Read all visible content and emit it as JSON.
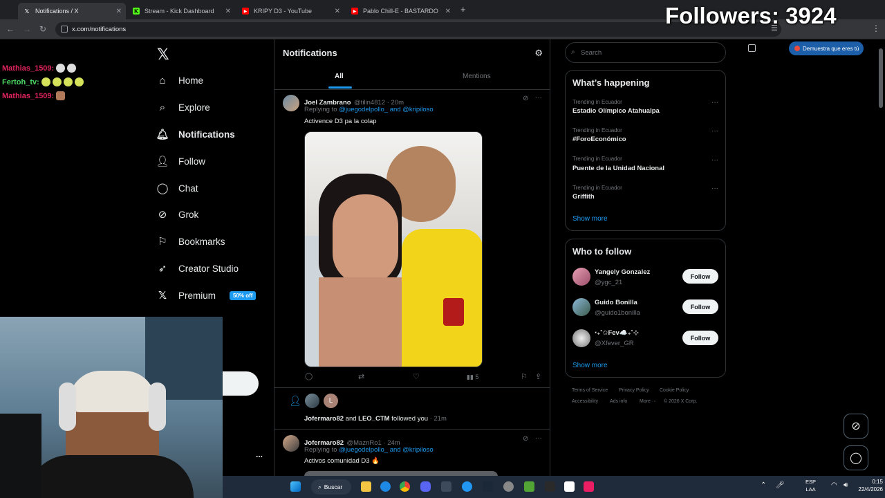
{
  "browser": {
    "tabs": [
      {
        "label": "Notifications / X",
        "icon": "x-icon",
        "active": true
      },
      {
        "label": "Stream - Kick Dashboard",
        "icon": "kick-icon",
        "active": false
      },
      {
        "label": "KRIPY D3 - YouTube",
        "icon": "youtube-icon",
        "active": false
      },
      {
        "label": "Pablo Chill-E - BASTARDO ft Ñe",
        "icon": "youtube-icon",
        "active": false
      }
    ],
    "url": "x.com/notifications",
    "verify_chip": "Demuestra que eres tú"
  },
  "overlay": {
    "followers": "Followers: 3924",
    "chat": [
      {
        "user": "Mathias_1509:",
        "color": "#e0245e"
      },
      {
        "user": "Fertoh_tv:",
        "color": "#4cd964"
      },
      {
        "user": "Mathias_1509:",
        "color": "#e0245e"
      }
    ]
  },
  "sidebar": {
    "items": [
      {
        "label": "Home",
        "icon": "home-icon"
      },
      {
        "label": "Explore",
        "icon": "search-icon"
      },
      {
        "label": "Notifications",
        "icon": "bell-icon"
      },
      {
        "label": "Follow",
        "icon": "add-person-icon"
      },
      {
        "label": "Chat",
        "icon": "chat-icon"
      },
      {
        "label": "Grok",
        "icon": "grok-icon"
      },
      {
        "label": "Bookmarks",
        "icon": "bookmark-icon"
      },
      {
        "label": "Creator Studio",
        "icon": "rocket-icon"
      },
      {
        "label": "Premium",
        "icon": "x-icon"
      }
    ],
    "premium_badge": "50% off",
    "more_dots": "..."
  },
  "main": {
    "title": "Notifications",
    "tabs": [
      "All",
      "Mentions"
    ],
    "posts": [
      {
        "name": "Joel Zambrano",
        "handle": "@tilin4812 · 20m",
        "replying_prefix": "Replying to",
        "reply_users": "@juegodelpollo_ and @kripiloso",
        "text": "Activence D3 pa la colap",
        "views": "5"
      },
      {
        "name": "Jofermaro82",
        "handle": "@MaznRo1 · 24m",
        "replying_prefix": "Replying to",
        "reply_users": "@juegodelpollo_ and @kripiloso",
        "text": "Activos comunidad D3 🔥"
      }
    ],
    "follow_notice": {
      "text_a": "Jofermaro82",
      "text_mid": "and",
      "text_b": "LEO_CTM",
      "text_end": "followed you",
      "time": "· 21m",
      "avatar_letter": "L"
    }
  },
  "right": {
    "search_placeholder": "Search",
    "trending_title": "What’s happening",
    "trends": [
      {
        "category": "Trending in Ecuador",
        "name": "Estadio Olímpico Atahualpa"
      },
      {
        "category": "Trending in Ecuador",
        "name": "#ForoEconómico"
      },
      {
        "category": "Trending in Ecuador",
        "name": "Puente de la Unidad Nacional"
      },
      {
        "category": "Trending in Ecuador",
        "name": "Griffith"
      }
    ],
    "show_more": "Show more",
    "wtf_title": "Who to follow",
    "follow_suggestions": [
      {
        "name": "Yangely Gonzalez",
        "handle": "@ygc_21",
        "button": "Follow"
      },
      {
        "name": "Guido Bonilla",
        "handle": "@guido1bonilla",
        "button": "Follow"
      },
      {
        "name": "‧₊˚✩Fev☁️₊˚⊹",
        "handle": "@Xfever_GR",
        "button": "Follow"
      }
    ],
    "footer": [
      "Terms of Service",
      "Privacy Policy",
      "Cookie Policy",
      "Accessibility",
      "Ads info",
      "More ···",
      "© 2026 X Corp."
    ]
  },
  "taskbar": {
    "search": "Buscar",
    "lang_a": "ESP",
    "lang_b": "LAA",
    "time": "0:15",
    "date": "22/4/2026"
  }
}
